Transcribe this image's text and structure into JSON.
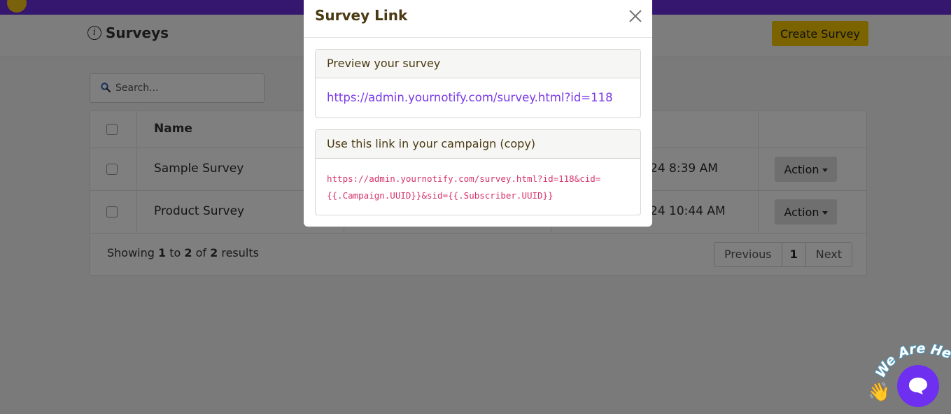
{
  "page": {
    "title": "Surveys",
    "create_label": "Create Survey",
    "search_placeholder": "Search..."
  },
  "table": {
    "headers": {
      "name": "Name"
    },
    "rows": [
      {
        "name": "Sample Survey",
        "time_fragment": "24 8:39 AM",
        "action_label": "Action"
      },
      {
        "name": "Product Survey",
        "time_fragment": "24 10:44 AM",
        "action_label": "Action"
      }
    ],
    "footer": {
      "showing_prefix": "Showing ",
      "from": "1",
      "to_word": " to ",
      "to": "2",
      "of_word": " of ",
      "total": "2",
      "results_word": " results"
    },
    "pagination": {
      "previous": "Previous",
      "current": "1",
      "next": "Next"
    }
  },
  "modal": {
    "title": "Survey Link",
    "preview_heading": "Preview your survey",
    "preview_url": "https://admin.yournotify.com/survey.html?id=118",
    "campaign_heading": "Use this link in your campaign (copy)",
    "campaign_code_line1": "https://admin.yournotify.com/survey.html?id=118&cid=",
    "campaign_code_line2": "{{.Campaign.UUID}}&sid={{.Subscriber.UUID}}"
  },
  "chat_widget": {
    "banner": "We Are Here!"
  },
  "colors": {
    "brand_purple": "#6b2fe0",
    "accent_yellow": "#f7c600",
    "link_purple": "#7a3ae8",
    "code_pink": "#d6336c"
  },
  "icons": [
    "info-icon",
    "search-icon",
    "close-icon",
    "chat-icon",
    "waving-hand-icon"
  ]
}
